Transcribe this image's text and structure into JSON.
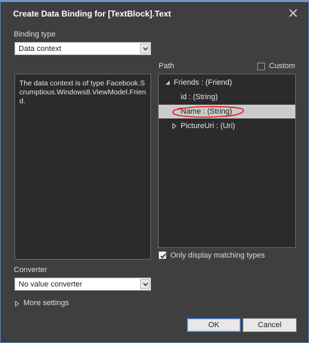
{
  "window": {
    "title": "Create Data Binding for [TextBlock].Text",
    "accent": "#6f97c9"
  },
  "binding_type": {
    "label": "Binding type",
    "selected": "Data context"
  },
  "description": "The data context is of type Facebook.Scrumptious.Windows8.ViewModel.Friend.",
  "path": {
    "label": "Path",
    "custom_label": "Custom",
    "custom_checked": false,
    "tree": [
      {
        "text": "Friends : (Friend)",
        "expander": "expanded",
        "selected": false
      },
      {
        "text": "id : (String)",
        "expander": "none",
        "selected": false
      },
      {
        "text": "Name : (String)",
        "expander": "none",
        "selected": true
      },
      {
        "text": "PictureUri : (Uri)",
        "expander": "collapsed",
        "selected": false
      }
    ],
    "annotation_color": "#e02020"
  },
  "only_matching": {
    "label": "Only display matching types",
    "checked": true
  },
  "converter": {
    "label": "Converter",
    "selected": "No value converter"
  },
  "more_settings": "More settings",
  "buttons": {
    "ok": "OK",
    "cancel": "Cancel"
  },
  "icons": {
    "close": "close-icon",
    "dropdown": "chevron-down-icon",
    "expanded": "triangle-expanded-icon",
    "collapsed": "triangle-collapsed-icon",
    "check": "checkmark-icon"
  }
}
